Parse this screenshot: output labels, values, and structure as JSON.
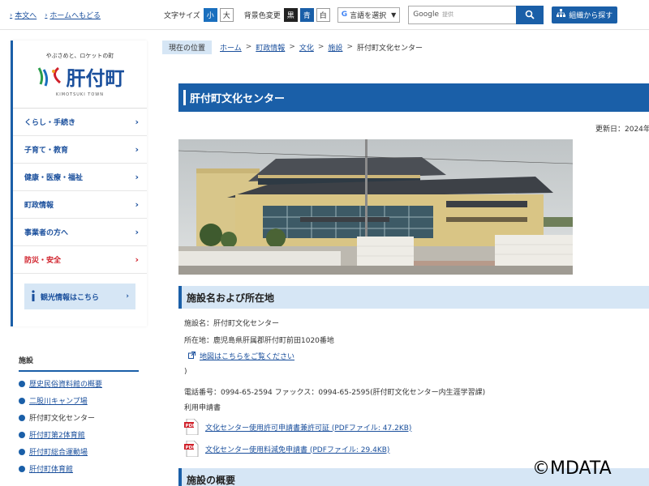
{
  "topbar": {
    "home_text_link": "本文へ",
    "home_link": "ホームへもどる",
    "font_size_label": "文字サイズ",
    "font_small": "小",
    "font_large": "大",
    "bg_label": "背景色変更",
    "bg_black": "黒",
    "bg_blue": "青",
    "bg_white": "白",
    "lang_label": "言語を選択",
    "search_brand": "Google",
    "search_sub": "提供",
    "org_button": "組織から探す"
  },
  "logo": {
    "tagline": "やぶさめと、ロケットの町",
    "name": "肝付町",
    "name_en": "KIMOTSUKI TOWN"
  },
  "nav": {
    "items": [
      {
        "label": "くらし・手続き"
      },
      {
        "label": "子育て・教育"
      },
      {
        "label": "健康・医療・福祉"
      },
      {
        "label": "町政情報"
      },
      {
        "label": "事業者の方へ"
      },
      {
        "label": "防災・安全"
      }
    ],
    "tourism": "観光情報はこちら"
  },
  "subnav": {
    "title": "施設",
    "items": [
      {
        "label": "歴史民俗資料館の概要"
      },
      {
        "label": "二股川キャンプ場"
      },
      {
        "label": "肝付町文化センター"
      },
      {
        "label": "肝付町第2体育館"
      },
      {
        "label": "肝付町総合運動場"
      },
      {
        "label": "肝付町体育館"
      }
    ]
  },
  "breadcrumb": {
    "here": "現在の位置",
    "items": [
      "ホーム",
      "町政情報",
      "文化",
      "施設"
    ],
    "current": "肝付町文化センター"
  },
  "main": {
    "title": "肝付町文化センター",
    "updated": "更新日：2024年",
    "section1": "施設名および所在地",
    "facility_name": "施設名：肝付町文化センター",
    "address": "所在地：鹿児島県肝属郡肝付町前田1020番地",
    "map_link": "地図はこちらをご覧ください",
    "paren": ")",
    "phone": "電話番号：0994-65-2594 ファックス：0994-65-2595(肝付町文化センター内生涯学習課)",
    "application_label": "利用申請書",
    "pdf1": "文化センター使用許可申請書兼許可証 (PDFファイル: 47.2KB)",
    "pdf2": "文化センター使用料減免申請書 (PDFファイル: 29.4KB)",
    "section2": "施設の概要"
  },
  "watermark": "©MDATA"
}
